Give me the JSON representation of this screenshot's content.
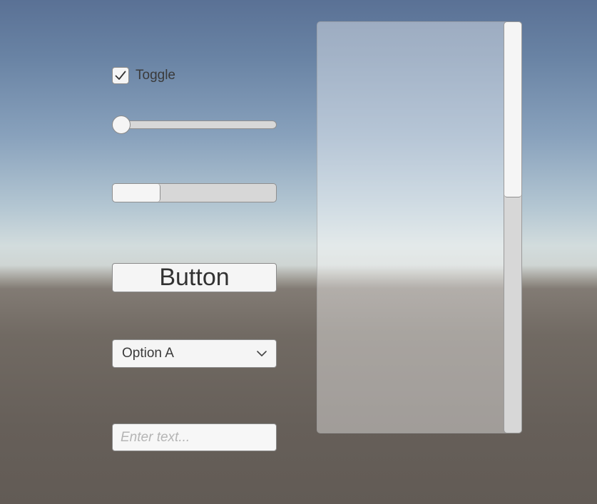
{
  "toggle": {
    "label": "Toggle",
    "checked": true,
    "icon": "checkmark-icon"
  },
  "slider": {
    "value": 0.0
  },
  "scrollbar_horizontal": {
    "value": 0.0,
    "size": 0.29
  },
  "button": {
    "label": "Button"
  },
  "dropdown": {
    "selected": "Option A",
    "icon": "chevron-down-icon"
  },
  "input": {
    "value": "",
    "placeholder": "Enter text..."
  },
  "scroll_view": {
    "scrollbar_vertical": {
      "value": 1.0,
      "size": 0.43
    }
  }
}
